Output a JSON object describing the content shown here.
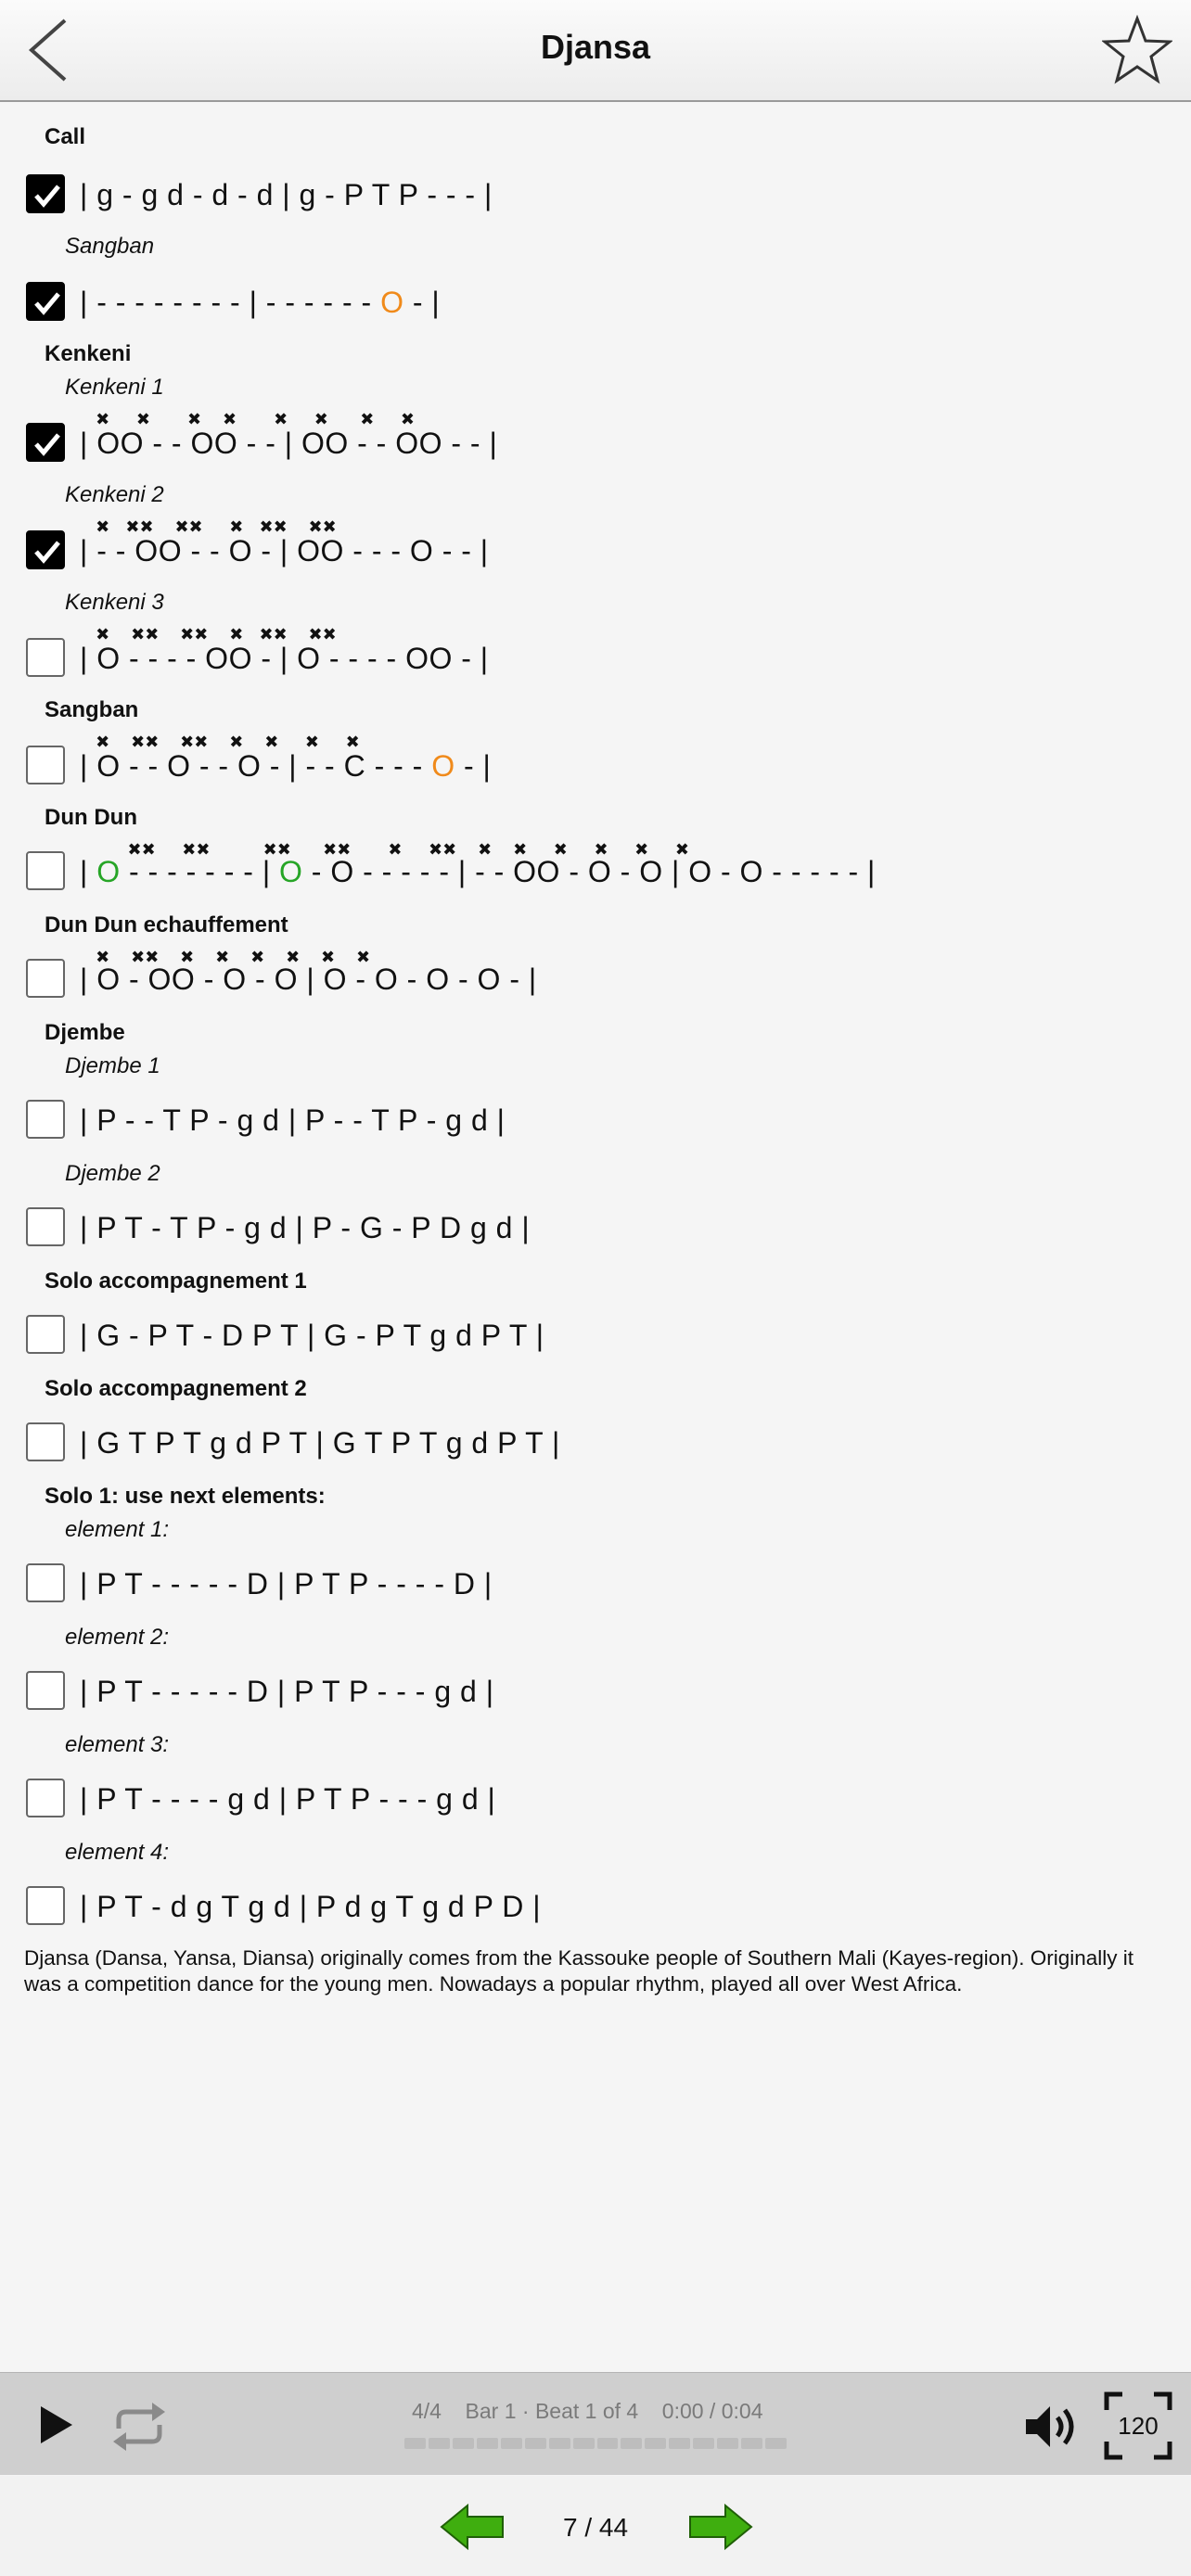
{
  "header": {
    "title": "Djansa"
  },
  "sections": {
    "call": "Call",
    "call_pattern": "| g - g d - d - d | g - P T P - - - |",
    "call_sub": "Sangban",
    "call_sub_pattern_a": "| - - - - - - - - | - - - - - - ",
    "call_sub_pattern_b": "O",
    "call_sub_pattern_c": " - |",
    "kenkeni": "Kenkeni",
    "k1": "Kenkeni 1",
    "k1_pattern": "| OO - - OO - - | OO - - OO - - |",
    "k2": "Kenkeni 2",
    "k2_pattern": "| - - OO - - O - | OO - - - O - - |",
    "k3": "Kenkeni 3",
    "k3_pattern": "| O - - - - OO - | O - - - - OO - |",
    "sangban": "Sangban",
    "sangban_a": "| O - - O - - O - | - - C - - - ",
    "sangban_b": "O",
    "sangban_c": " - |",
    "dundun": "Dun Dun",
    "dd_a": "| ",
    "dd_b": "O",
    "dd_c": " - - - - - - - | ",
    "dd_d": "O",
    "dd_e": " - O - - - - - | - - OO - O - O | O - O - - - - - |",
    "dd_ech": "Dun Dun echauffement",
    "dd_ech_pattern": "| O - OO - O - O | O - O - O - O - |",
    "djembe": "Djembe",
    "dj1": "Djembe 1",
    "dj1_pattern": "| P - - T P - g d | P - - T P - g d |",
    "dj2": "Djembe 2",
    "dj2_pattern": "| P T - T P - g d | P - G - P D g d |",
    "solo1": "Solo accompagnement 1",
    "solo1_pattern": "| G - P T - D P T | G - P T g d P T |",
    "solo2": "Solo accompagnement 2",
    "solo2_pattern": "| G T P T g d P T | G T P T g d P T |",
    "solo_next": "Solo 1: use next elements:",
    "e1": "element 1:",
    "e1_pattern": "| P T - - - - - D | P T P - - - - D |",
    "e2": "element 2:",
    "e2_pattern": "| P T - - - - - D | P T P - - - g d |",
    "e3": "element 3:",
    "e3_pattern": "| P T - - - - g d | P T P - - - g d |",
    "e4": "element 4:",
    "e4_pattern": "| P T - d g T g d | P d g T g d P D |"
  },
  "checkboxes": {
    "call": true,
    "call_sub": true,
    "k1": true,
    "k2": true,
    "k3": false,
    "sangban": false,
    "dundun": false,
    "dd_ech": false,
    "dj1": false,
    "dj2": false,
    "solo1": false,
    "solo2": false,
    "e1": false,
    "e2": false,
    "e3": false,
    "e4": false
  },
  "description": "Djansa (Dansa, Yansa, Diansa) originally comes from the Kassouke people of Southern Mali (Kayes-region). Originally it was a competition dance for the young men. Nowadays a popular rhythm, played all over West Africa.",
  "player": {
    "meter": "4/4",
    "position": "Bar 1 · Beat 1 of 4",
    "time": "0:00 / 0:04",
    "tempo": "120",
    "progress": 0
  },
  "nav": {
    "pages": "7 / 44"
  },
  "colors": {
    "green": "#26a526",
    "orange": "#f08a1a",
    "arrow": "#3fae0f"
  },
  "icons": [
    "back-chevron-icon",
    "star-icon",
    "play-icon",
    "repeat-icon",
    "speaker-icon",
    "fullscreen-icon",
    "arrow-left-icon",
    "arrow-right-icon",
    "check-icon"
  ]
}
